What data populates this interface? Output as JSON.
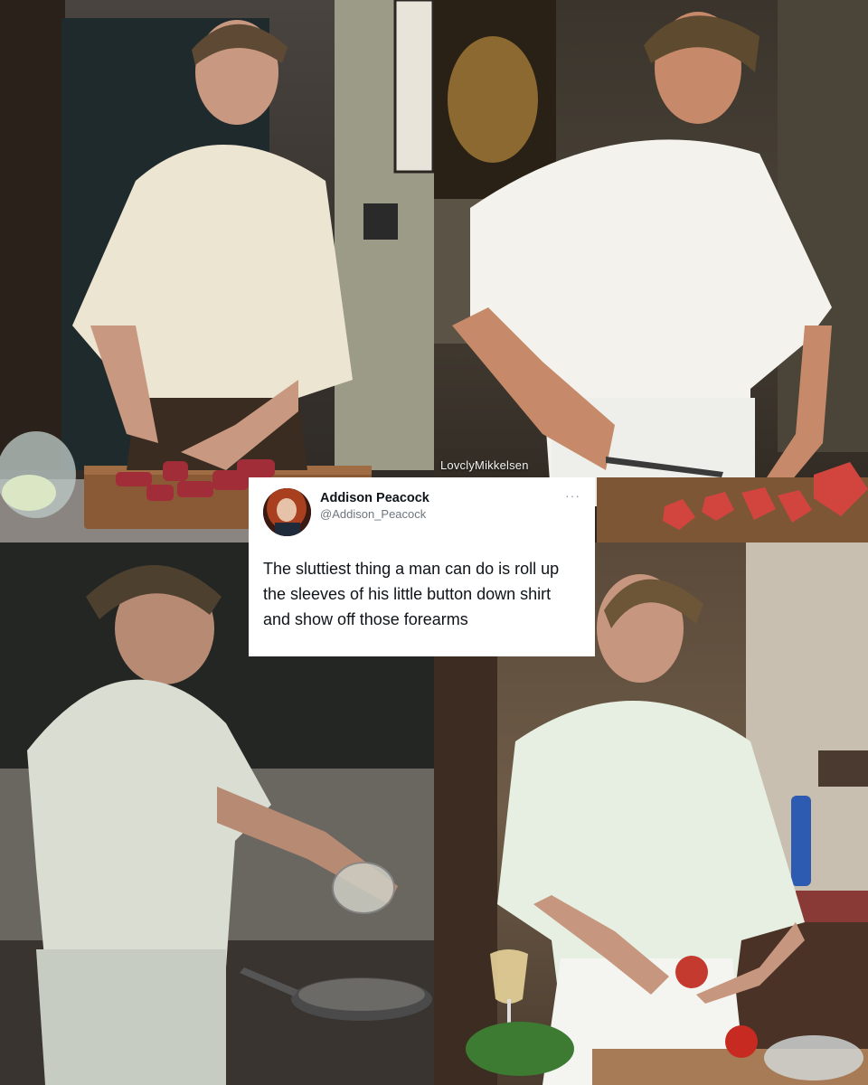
{
  "photos": {
    "top_left": "chef-cutting-meat",
    "top_right": "chef-chopping-tomatoes",
    "bottom_left": "chef-pouring-into-pan",
    "bottom_right": "chef-holding-tomato"
  },
  "watermark": "LovclyMikkelsen",
  "tweet": {
    "display_name": "Addison Peacock",
    "handle": "@Addison_Peacock",
    "more_icon": "more-dots-icon",
    "text": "The sluttiest thing a man can do is roll up the sleeves of his little button down shirt and show off those forearms"
  }
}
